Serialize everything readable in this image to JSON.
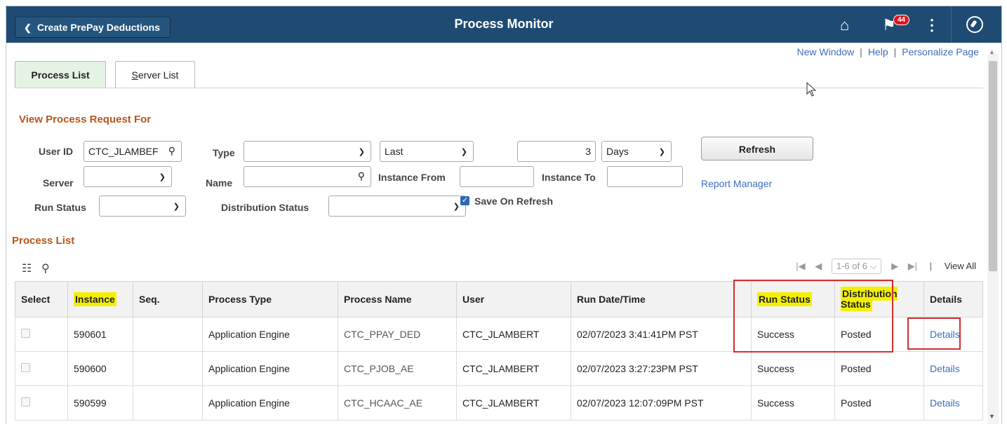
{
  "header": {
    "back_label": "Create PrePay Deductions",
    "title": "Process Monitor",
    "notification_count": "44",
    "icons": [
      "home-icon",
      "flag-icon",
      "kebab-menu-icon",
      "compass-icon"
    ]
  },
  "top_links": {
    "new_window": "New Window",
    "help": "Help",
    "personalize": "Personalize Page"
  },
  "tabs": [
    {
      "label": "Process List",
      "active": true
    },
    {
      "label": "Server List",
      "active": false
    }
  ],
  "filters": {
    "section_title": "View Process Request For",
    "user_id_label": "User ID",
    "user_id_value": "CTC_JLAMBEF",
    "type_label": "Type",
    "type_value": "",
    "period_value": "Last",
    "period_count": "3",
    "period_unit": "Days",
    "refresh_label": "Refresh",
    "server_label": "Server",
    "server_value": "",
    "name_label": "Name",
    "name_value": "",
    "instance_from_label": "Instance From",
    "instance_to_label": "Instance To",
    "report_manager": "Report Manager",
    "run_status_label": "Run Status",
    "distribution_status_label": "Distribution Status",
    "save_on_refresh": "Save On Refresh",
    "save_on_refresh_checked": true
  },
  "process_list": {
    "section_title": "Process List",
    "pager_range": "1-6 of 6",
    "view_all": "View All",
    "columns": [
      "Select",
      "Instance",
      "Seq.",
      "Process Type",
      "Process Name",
      "User",
      "Run Date/Time",
      "Run Status",
      "Distribution Status",
      "Details"
    ],
    "rows": [
      {
        "instance": "590601",
        "seq": "",
        "process_type": "Application Engine",
        "process_name": "CTC_PPAY_DED",
        "user": "CTC_JLAMBERT",
        "run_datetime": "02/07/2023  3:41:41PM PST",
        "run_status": "Success",
        "distribution_status": "Posted",
        "details": "Details"
      },
      {
        "instance": "590600",
        "seq": "",
        "process_type": "Application Engine",
        "process_name": "CTC_PJOB_AE",
        "user": "CTC_JLAMBERT",
        "run_datetime": "02/07/2023  3:27:23PM PST",
        "run_status": "Success",
        "distribution_status": "Posted",
        "details": "Details"
      },
      {
        "instance": "590599",
        "seq": "",
        "process_type": "Application Engine",
        "process_name": "CTC_HCAAC_AE",
        "user": "CTC_JLAMBERT",
        "run_datetime": "02/07/2023 12:07:09PM PST",
        "run_status": "Success",
        "distribution_status": "Posted",
        "details": "Details"
      }
    ]
  },
  "colors": {
    "header_bg": "#1f4b73",
    "section_title": "#b5561c",
    "link": "#3d6ebf",
    "highlight": "#f4f000",
    "annotation": "#d12f2f",
    "active_tab": "#e5f3e5"
  }
}
